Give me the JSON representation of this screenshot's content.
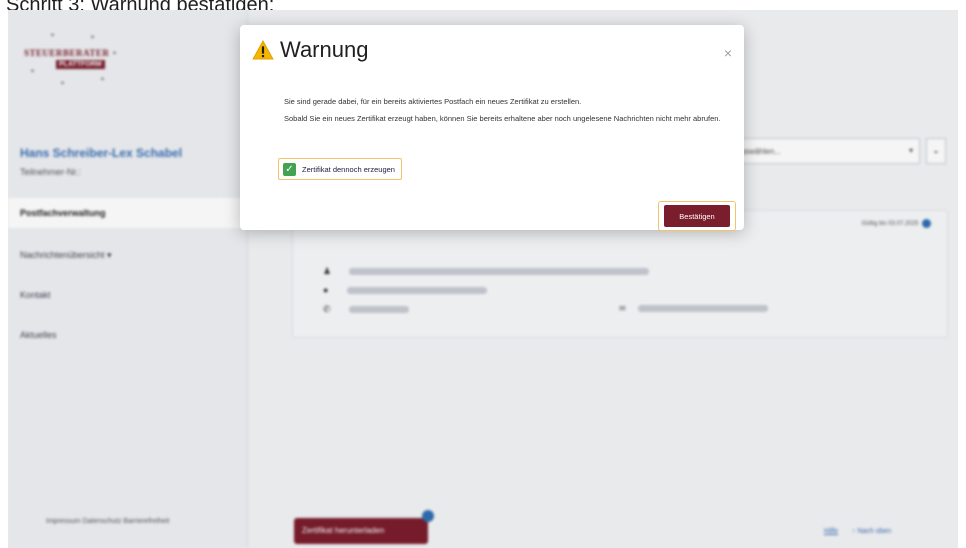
{
  "caption": "Schritt 3: Warnung bestätigen:",
  "logo": {
    "line1": "STEUERBERATER",
    "line2": "PLATTFORM"
  },
  "sidebar": {
    "user_name": "Hans Schreiber-Lex Schabel",
    "user_number_label": "Teilnehmer-Nr.:",
    "items": [
      {
        "label": "Postfachverwaltung",
        "active": true
      },
      {
        "label": "Nachrichtenübersicht ▾",
        "active": false
      },
      {
        "label": "Kontakt",
        "active": false
      },
      {
        "label": "Aktuelles",
        "active": false
      }
    ],
    "footer": "Impressum  Datenschutz  Barrierefreiheit"
  },
  "main": {
    "select_placeholder": "Auswählen...",
    "valid_text": "Gültig bis 03.07.2025",
    "download_button": "Zertifikat herunterladen",
    "help_link": "Hilfe",
    "top_link": "↑ Nach oben"
  },
  "modal": {
    "title": "Warnung",
    "close": "×",
    "body_p1": "Sie sind gerade dabei, für ein bereits aktiviertes Postfach ein neues Zertifikat zu erstellen.",
    "body_p2": "Sobald Sie ein neues Zertifikat erzeugt haben, können Sie bereits erhaltene aber noch ungelesene Nachrichten nicht mehr abrufen.",
    "checkbox_label": "Zertifikat dennoch erzeugen",
    "checkbox_checked": true,
    "confirm_button": "Bestätigen"
  },
  "colors": {
    "brand": "#7a1d2c",
    "accent": "#2f6fb3",
    "highlight": "#f2c36a",
    "check": "#43a353"
  },
  "icons": [
    "warning-icon",
    "close-icon",
    "check-icon",
    "person-icon",
    "location-icon",
    "phone-icon",
    "email-icon",
    "info-icon"
  ]
}
